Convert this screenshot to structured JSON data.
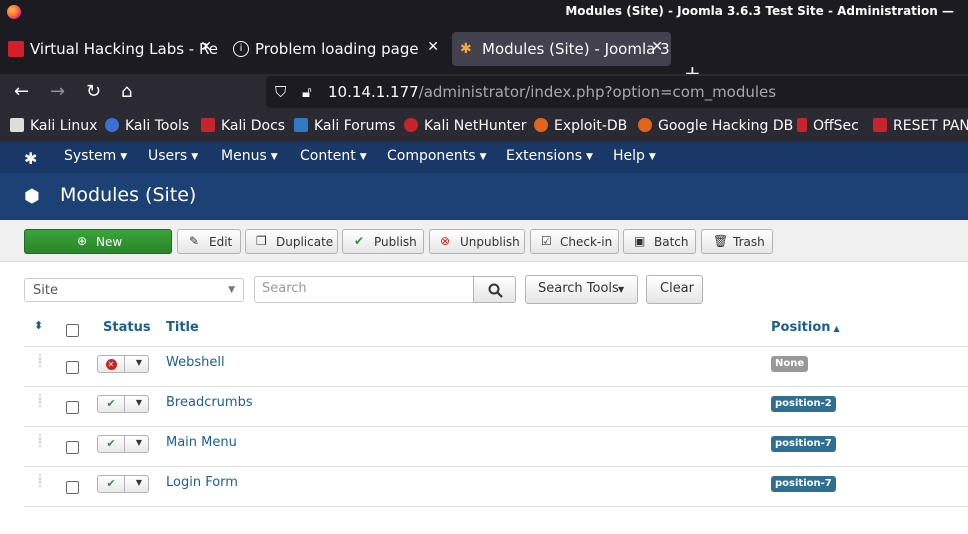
{
  "browser": {
    "window_title": "Modules (Site) - Joomla 3.6.3 Test Site - Administration —",
    "tabs": [
      {
        "label": "Virtual Hacking Labs - Re",
        "active": false
      },
      {
        "label": "Problem loading page",
        "active": false
      },
      {
        "label": "Modules (Site) - Joomla 3",
        "active": true
      }
    ],
    "url_host": "10.14.1.177",
    "url_path": "/administrator/index.php?option=com_modules",
    "bookmarks": [
      "Kali Linux",
      "Kali Tools",
      "Kali Docs",
      "Kali Forums",
      "Kali NetHunter",
      "Exploit-DB",
      "Google Hacking DB",
      "OffSec",
      "RESET PAN"
    ]
  },
  "nav": {
    "menus": [
      "System",
      "Users",
      "Menus",
      "Content",
      "Components",
      "Extensions",
      "Help"
    ]
  },
  "page": {
    "title": "Modules (Site)"
  },
  "toolbar": {
    "new": "New",
    "edit": "Edit",
    "duplicate": "Duplicate",
    "publish": "Publish",
    "unpublish": "Unpublish",
    "checkin": "Check-in",
    "batch": "Batch",
    "trash": "Trash"
  },
  "filters": {
    "client_value": "Site",
    "search_placeholder": "Search",
    "search_tools": "Search Tools",
    "clear": "Clear"
  },
  "table": {
    "headers": {
      "status": "Status",
      "title": "Title",
      "position": "Position"
    },
    "rows": [
      {
        "title": "Webshell",
        "status": "unpublished",
        "position": "None",
        "position_color": "#999999"
      },
      {
        "title": "Breadcrumbs",
        "status": "published",
        "position": "position-2",
        "position_color": "#2f6f91"
      },
      {
        "title": "Main Menu",
        "status": "published",
        "position": "position-7",
        "position_color": "#2f6f91"
      },
      {
        "title": "Login Form",
        "status": "published",
        "position": "position-7",
        "position_color": "#2f6f91"
      }
    ]
  },
  "colors": {
    "nav_bg": "#1a3867",
    "title_bg": "#1b4175",
    "new_button": "#2f8f2f",
    "link": "#1b5f93"
  }
}
